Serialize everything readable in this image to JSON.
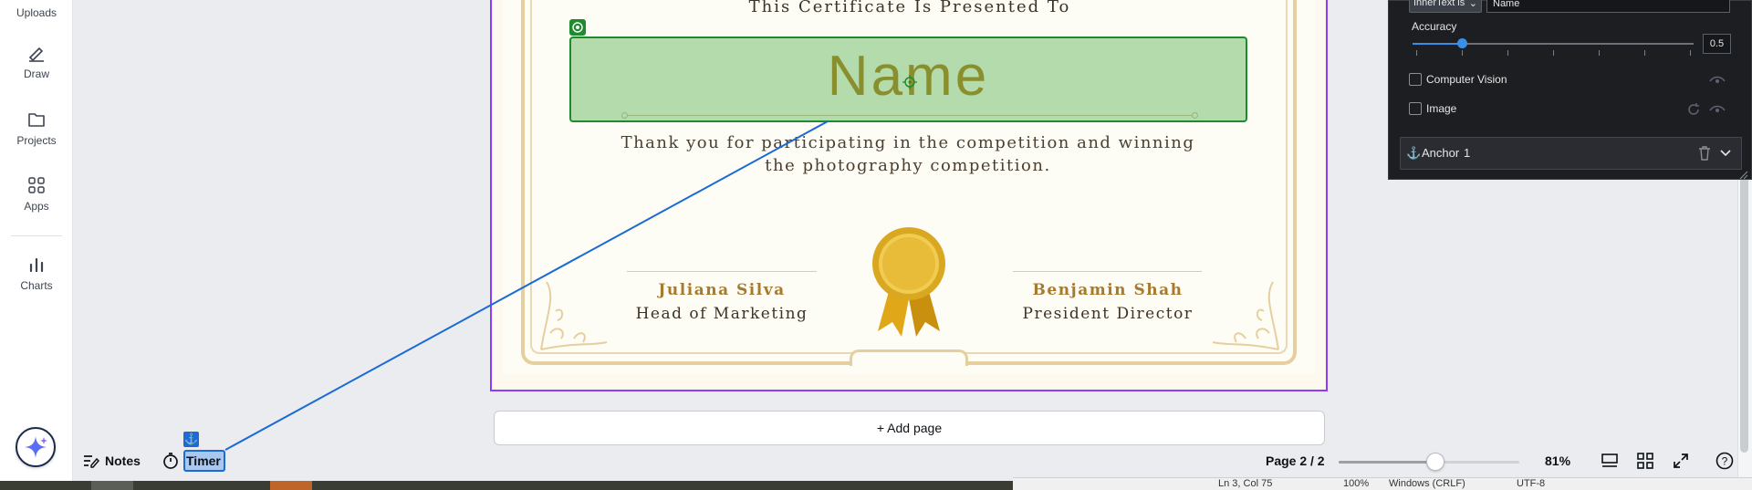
{
  "left_rail": {
    "items": [
      {
        "label": "Uploads",
        "icon": "upload-icon"
      },
      {
        "label": "Draw",
        "icon": "pen-icon"
      },
      {
        "label": "Projects",
        "icon": "folder-icon"
      },
      {
        "label": "Apps",
        "icon": "apps-grid-icon"
      },
      {
        "label": "Charts",
        "icon": "bar-chart-icon"
      }
    ]
  },
  "certificate": {
    "presented_to": "This Certificate Is Presented To",
    "name": "Name",
    "message_line1": "Thank you for participating in the competition and winning",
    "message_line2": "the photography competition.",
    "signer_left": {
      "name": "Juliana Silva",
      "title": "Head of Marketing"
    },
    "signer_right": {
      "name": "Benjamin Shah",
      "title": "President Director"
    },
    "colors": {
      "gold": "#a67b2f",
      "selection_fill": "#b3dbab",
      "selection_border": "#1f8a2e",
      "page_border": "#8b3dff"
    }
  },
  "canvas": {
    "add_page_label": "+ Add page"
  },
  "bottom_bar": {
    "notes_label": "Notes",
    "timer_label": "Timer",
    "page_indicator": "Page 2 / 2",
    "zoom_level": "81%",
    "zoom_fraction": 0.53
  },
  "panel": {
    "select_value": "InnerText is",
    "input_value": "Name",
    "accuracy_label": "Accuracy",
    "accuracy_value": "0.5",
    "option_computer_vision": "Computer Vision",
    "option_image": "Image",
    "anchor_label": "Anchor",
    "anchor_number": "1",
    "accent": "#3b8ee6"
  },
  "status_strip": {
    "position": "Ln 3, Col 75",
    "zoom": "100%",
    "line_ending": "Windows (CRLF)",
    "encoding": "UTF-8"
  }
}
